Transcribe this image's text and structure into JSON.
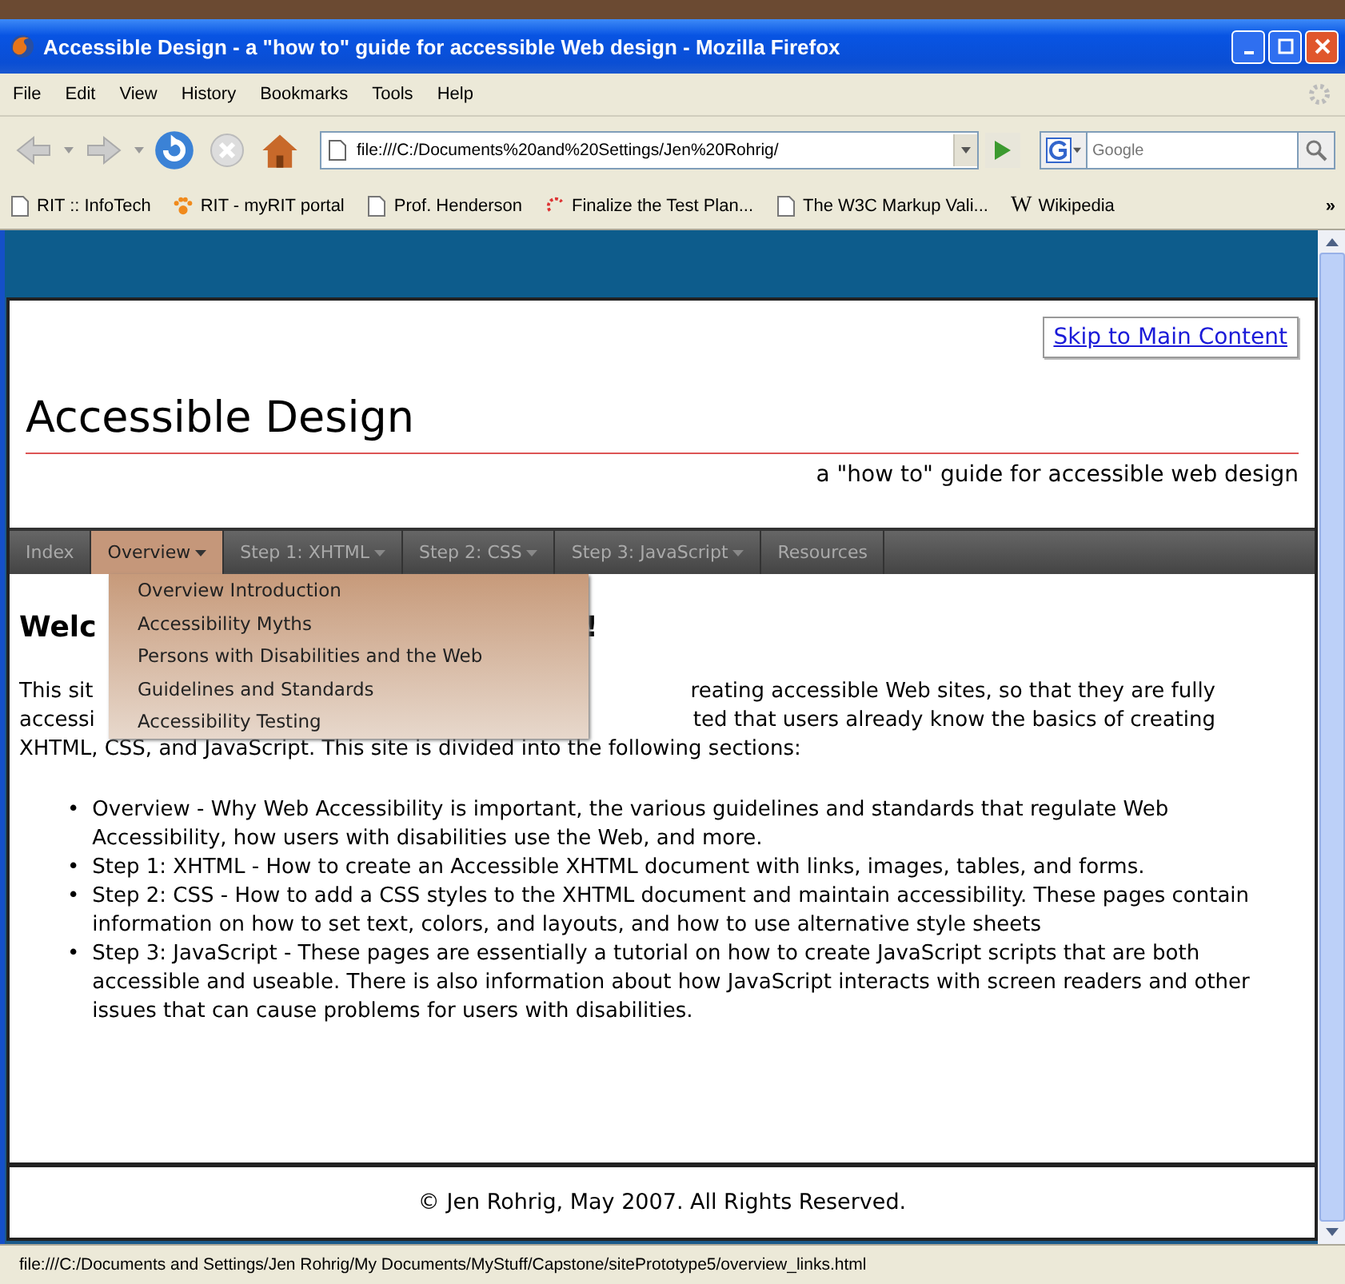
{
  "window": {
    "title": "Accessible Design - a \"how to\" guide for accessible Web design - Mozilla Firefox"
  },
  "menu_bar": [
    "File",
    "Edit",
    "View",
    "History",
    "Bookmarks",
    "Tools",
    "Help"
  ],
  "toolbar": {
    "url": "file:///C:/Documents%20and%20Settings/Jen%20Rohrig/",
    "search_placeholder": "Google"
  },
  "bookmarks": [
    {
      "label": "RIT :: InfoTech",
      "kind": "page"
    },
    {
      "label": "RIT - myRIT portal",
      "kind": "paw"
    },
    {
      "label": "Prof. Henderson",
      "kind": "page"
    },
    {
      "label": "Finalize the Test Plan...",
      "kind": "swirl"
    },
    {
      "label": "The W3C Markup Vali...",
      "kind": "page"
    },
    {
      "label": "Wikipedia",
      "kind": "wiki",
      "glyph": "W"
    }
  ],
  "bookmarks_more": "»",
  "page": {
    "skip_link": "Skip to Main Content",
    "site_title": "Accessible Design",
    "tagline": "a \"how to\" guide for accessible web design",
    "nav": [
      {
        "label": "Index",
        "selected": false,
        "has_menu": false
      },
      {
        "label": "Overview",
        "selected": true,
        "has_menu": true
      },
      {
        "label": "Step 1: XHTML",
        "selected": false,
        "has_menu": true
      },
      {
        "label": "Step 2: CSS",
        "selected": false,
        "has_menu": true
      },
      {
        "label": "Step 3: JavaScript",
        "selected": false,
        "has_menu": true
      },
      {
        "label": "Resources",
        "selected": false,
        "has_menu": false
      }
    ],
    "dropdown": [
      "Overview Introduction",
      "Accessibility Myths",
      "Persons with Disabilities and the Web",
      "Guidelines and Standards",
      "Accessibility Testing"
    ],
    "heading_parts": [
      "Welc",
      "!"
    ],
    "intro_rows": [
      {
        "left": "This sit",
        "right": "reating accessible Web sites, so that they are fully"
      },
      {
        "left": "accessi",
        "right": "ted that users already know the basics of creating"
      }
    ],
    "intro_last": "XHTML, CSS, and JavaScript. This site is divided into the following sections:",
    "bullet": "•",
    "sections": [
      "Overview - Why Web Accessibility is important, the various guidelines and standards that regulate Web Accessibility, how users with disabilities use the Web, and more.",
      "Step 1: XHTML - How to create an Accessible XHTML document with links, images, tables, and forms.",
      "Step 2: CSS - How to add a CSS styles to the XHTML document and maintain accessibility. These pages contain information on how to set text, colors, and layouts, and how to use alternative style sheets",
      "Step 3: JavaScript - These pages are essentially a tutorial on how to create JavaScript scripts that are both accessible and useable. There is also information about how JavaScript interacts with screen readers and other issues that can cause problems for users with disabilities."
    ],
    "footer": "© Jen Rohrig, May 2007. All Rights Reserved."
  },
  "status_bar": "file:///C:/Documents and Settings/Jen Rohrig/My Documents/MyStuff/Capstone/sitePrototype5/overview_links.html"
}
